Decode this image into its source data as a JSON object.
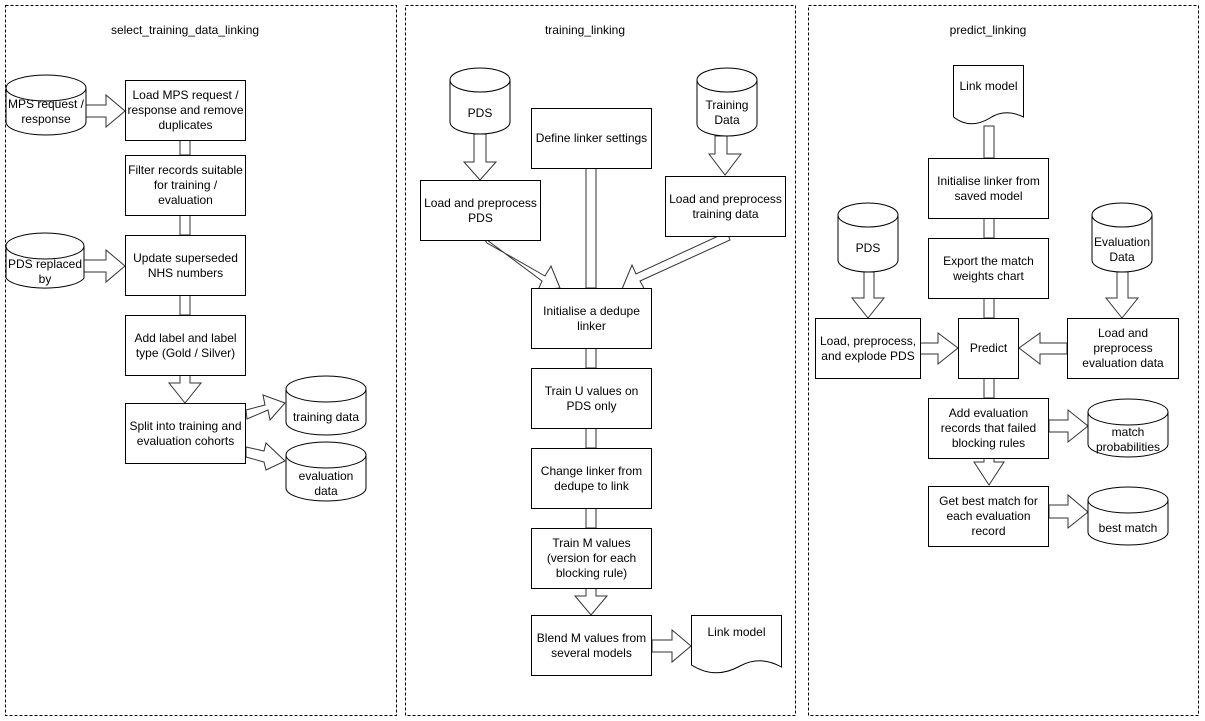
{
  "panels": [
    {
      "title": "select_training_data_linking",
      "nodes": {
        "mps_store": "MPS request / response",
        "load_mps": "Load MPS request / response and remove duplicates",
        "filter": "Filter records suitable for training / evaluation",
        "pds_replaced": "PDS replaced by",
        "update_nhs": "Update superseded NHS numbers",
        "add_label": "Add label and label type (Gold / Silver)",
        "split": "Split into training and evaluation cohorts",
        "training_data": "training data",
        "evaluation_data": "evaluation data"
      }
    },
    {
      "title": "training_linking",
      "nodes": {
        "pds_store": "PDS",
        "define_settings": "Define linker settings",
        "training_store": "Training Data",
        "load_pds": "Load and preprocess PDS",
        "load_training": "Load and preprocess training data",
        "init_dedupe": "Initialise a dedupe linker",
        "train_u": "Train U values on PDS only",
        "change_linker": "Change linker from dedupe to link",
        "train_m": "Train M values (version for each blocking rule)",
        "blend_m": "Blend M values from several models",
        "link_model_out": "Link model"
      }
    },
    {
      "title": "predict_linking",
      "nodes": {
        "link_model_in": "Link model",
        "init_saved": "Initialise linker from saved model",
        "pds_store": "PDS",
        "eval_store": "Evaluation Data",
        "export_chart": "Export the match weights chart",
        "load_explode_pds": "Load, preprocess, and explode PDS",
        "predict": "Predict",
        "load_eval": "Load and preprocess evaluation data",
        "add_failed": "Add evaluation records that failed blocking rules",
        "match_probs": "match probabilities",
        "best_match_step": "Get best match for each evaluation record",
        "best_match": "best match"
      }
    }
  ]
}
